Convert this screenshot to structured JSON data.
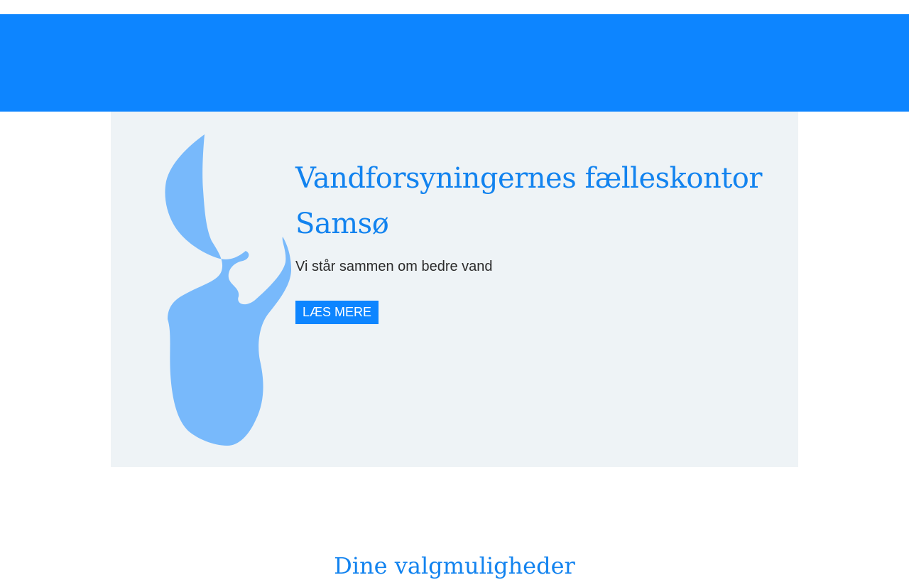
{
  "colors": {
    "header_blue": "#0d85ff",
    "hero_background": "#eef3f6",
    "title_blue": "#1283ef",
    "island_blue": "#78b9fb",
    "text_dark": "#2b2b2b"
  },
  "hero": {
    "title": "Vandforsyningernes fælleskontor Samsø",
    "subtitle": "Vi står sammen om bedre vand",
    "button_label": "LÆS MERE",
    "image_icon": "samso-island-map"
  },
  "sections": {
    "options_title": "Dine valgmuligheder"
  }
}
